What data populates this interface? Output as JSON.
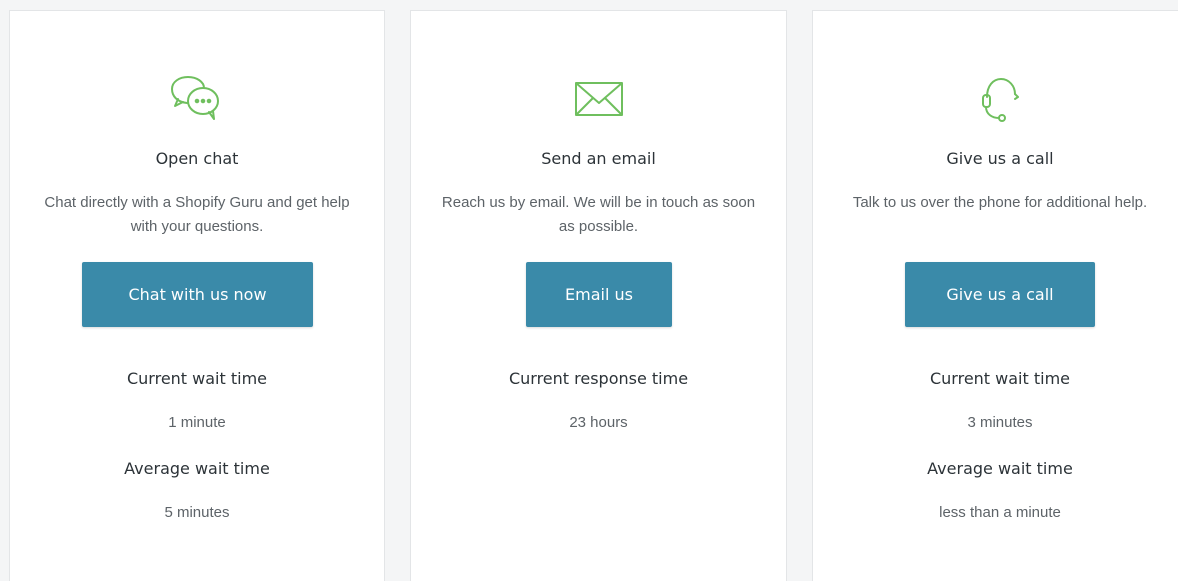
{
  "colors": {
    "accent": "#3a8aa9",
    "icon_green": "#6fbf5e",
    "heading": "#2c3338",
    "body_text": "#5d6368"
  },
  "cards": [
    {
      "icon": "chat-bubbles-icon",
      "title": "Open chat",
      "description": "Chat directly with a Shopify Guru and get help with your questions.",
      "button_label": "Chat with us now",
      "stats": [
        {
          "label": "Current wait time",
          "value": "1 minute"
        },
        {
          "label": "Average wait time",
          "value": "5 minutes"
        }
      ]
    },
    {
      "icon": "envelope-icon",
      "title": "Send an email",
      "description": "Reach us by email. We will be in touch as soon as possible.",
      "button_label": "Email us",
      "stats": [
        {
          "label": "Current response time",
          "value": "23 hours"
        }
      ]
    },
    {
      "icon": "headset-icon",
      "title": "Give us a call",
      "description": "Talk to us over the phone for additional help.",
      "button_label": "Give us a call",
      "stats": [
        {
          "label": "Current wait time",
          "value": "3 minutes"
        },
        {
          "label": "Average wait time",
          "value": "less than a minute"
        }
      ]
    }
  ]
}
